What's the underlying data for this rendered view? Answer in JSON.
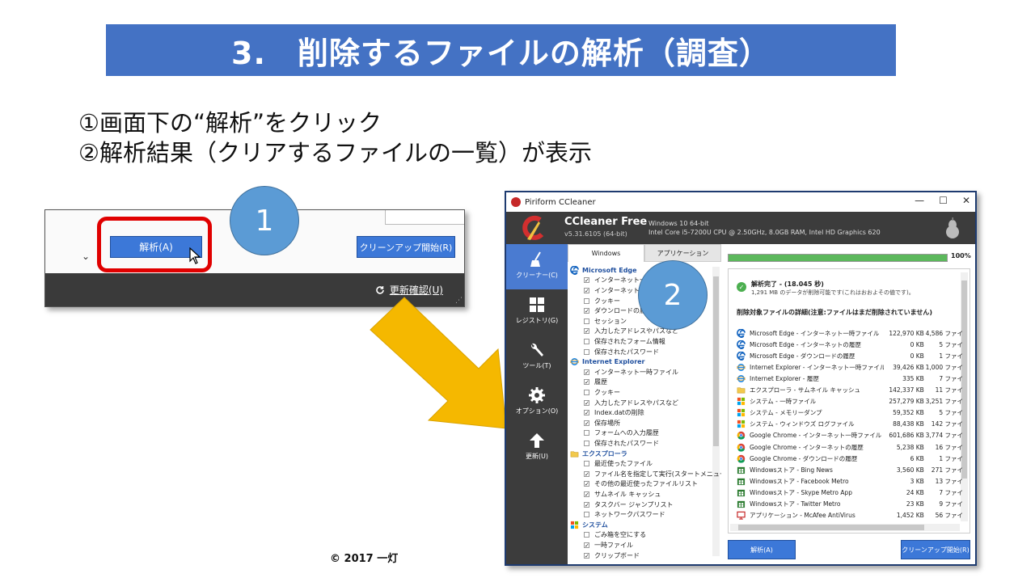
{
  "slide": {
    "title": "3.　削除するファイルの解析（調査）",
    "instruction_1": "①画面下の“解析”をクリック",
    "instruction_2": "②解析結果（クリアするファイルの一覧）が表示",
    "badge_1": "1",
    "badge_2": "2",
    "copyright": "© 2017 一灯"
  },
  "crop": {
    "analyze_button": "解析(A)",
    "cleanup_button": "クリーンアップ開始(R)",
    "update_check": "更新確認(U)",
    "chevron": "⌄"
  },
  "window": {
    "title": "Piriform CCleaner",
    "product": "CCleaner Free",
    "version": "v5.31.6105 (64-bit)",
    "system_line_1": "Windows 10 64-bit",
    "system_line_2": "Intel Core i5-7200U CPU @ 2.50GHz, 8.0GB RAM, Intel HD Graphics 620",
    "controls": {
      "minimize": "—",
      "maximize": "☐",
      "close": "✕"
    }
  },
  "sidebar": {
    "items": [
      {
        "label": "クリーナー(C)",
        "icon": "broom-icon"
      },
      {
        "label": "レジストリ(G)",
        "icon": "registry-grid-icon"
      },
      {
        "label": "ツール(T)",
        "icon": "wrench-icon"
      },
      {
        "label": "オプション(O)",
        "icon": "gear-icon"
      },
      {
        "label": "更新(U)",
        "icon": "upload-arrow-icon"
      }
    ]
  },
  "tabs": {
    "windows": "Windows",
    "applications": "アプリケーション"
  },
  "tree": [
    {
      "type": "section",
      "label": "Microsoft Edge",
      "icon": "edge-icon"
    },
    {
      "type": "item",
      "label": "インターネット一時ファイル",
      "checked": true
    },
    {
      "type": "item",
      "label": "インターネットの履歴",
      "checked": true
    },
    {
      "type": "item",
      "label": "クッキー",
      "checked": false
    },
    {
      "type": "item",
      "label": "ダウンロードの履歴",
      "checked": true
    },
    {
      "type": "item",
      "label": "セッション",
      "checked": false
    },
    {
      "type": "item",
      "label": "入力したアドレスやパスなど",
      "checked": true
    },
    {
      "type": "item",
      "label": "保存されたフォーム情報",
      "checked": false
    },
    {
      "type": "item",
      "label": "保存されたパスワード",
      "checked": false
    },
    {
      "type": "section",
      "label": "Internet Explorer",
      "icon": "ie-icon"
    },
    {
      "type": "item",
      "label": "インターネット一時ファイル",
      "checked": true
    },
    {
      "type": "item",
      "label": "履歴",
      "checked": true
    },
    {
      "type": "item",
      "label": "クッキー",
      "checked": false
    },
    {
      "type": "item",
      "label": "入力したアドレスやパスなど",
      "checked": true
    },
    {
      "type": "item",
      "label": "Index.datの削除",
      "checked": true
    },
    {
      "type": "item",
      "label": "保存場所",
      "checked": true
    },
    {
      "type": "item",
      "label": "フォームへの入力履歴",
      "checked": false
    },
    {
      "type": "item",
      "label": "保存されたパスワード",
      "checked": false
    },
    {
      "type": "section",
      "label": "エクスプローラ",
      "icon": "folder-icon"
    },
    {
      "type": "item",
      "label": "最近使ったファイル",
      "checked": false
    },
    {
      "type": "item",
      "label": "ファイル名を指定して実行(スタートメニュー)",
      "checked": true
    },
    {
      "type": "item",
      "label": "その他の最近使ったファイルリスト",
      "checked": true
    },
    {
      "type": "item",
      "label": "サムネイル キャッシュ",
      "checked": true
    },
    {
      "type": "item",
      "label": "タスクバー ジャンプリスト",
      "checked": true
    },
    {
      "type": "item",
      "label": "ネットワークパスワード",
      "checked": false
    },
    {
      "type": "section",
      "label": "システム",
      "icon": "windows-icon"
    },
    {
      "type": "item",
      "label": "ごみ箱を空にする",
      "checked": false
    },
    {
      "type": "item",
      "label": "一時ファイル",
      "checked": true
    },
    {
      "type": "item",
      "label": "クリップボード",
      "checked": true
    }
  ],
  "progress": {
    "percent_label": "100%",
    "fraction": 1.0
  },
  "result": {
    "done_title": "解析完了 - (18.045 秒)",
    "done_sub": "1,291 MB のデータが削除可能です(これはおおよその値です)。",
    "detail_title": "削除対象ファイルの詳細(注意:ファイルはまだ削除されていません)",
    "rows": [
      {
        "name": "Microsoft Edge - インターネット一時ファイル",
        "size": "122,970 KB",
        "count": "4,586 ファイ",
        "icon": "edge-icon"
      },
      {
        "name": "Microsoft Edge - インターネットの履歴",
        "size": "0 KB",
        "count": "5 ファイ",
        "icon": "edge-icon"
      },
      {
        "name": "Microsoft Edge - ダウンロードの履歴",
        "size": "0 KB",
        "count": "1 ファイ",
        "icon": "edge-icon"
      },
      {
        "name": "Internet Explorer - インターネット一時ファイル",
        "size": "39,426 KB",
        "count": "1,000 ファイ",
        "icon": "ie-icon"
      },
      {
        "name": "Internet Explorer - 履歴",
        "size": "335 KB",
        "count": "7 ファイ",
        "icon": "ie-icon"
      },
      {
        "name": "エクスプローラ - サムネイル キャッシュ",
        "size": "142,337 KB",
        "count": "11 ファイ",
        "icon": "folder-icon"
      },
      {
        "name": "システム - 一時ファイル",
        "size": "257,279 KB",
        "count": "3,251 ファイ",
        "icon": "windows-icon"
      },
      {
        "name": "システム - メモリーダンプ",
        "size": "59,352 KB",
        "count": "5 ファイ",
        "icon": "windows-icon"
      },
      {
        "name": "システム - ウィンドウズ ログファイル",
        "size": "88,438 KB",
        "count": "142 ファイ",
        "icon": "windows-icon"
      },
      {
        "name": "Google Chrome - インターネット一時ファイル",
        "size": "601,686 KB",
        "count": "3,774 ファイ",
        "icon": "chrome-icon"
      },
      {
        "name": "Google Chrome - インターネットの履歴",
        "size": "5,238 KB",
        "count": "16 ファイ",
        "icon": "chrome-icon"
      },
      {
        "name": "Google Chrome - ダウンロードの履歴",
        "size": "6 KB",
        "count": "1 ファイ",
        "icon": "chrome-icon"
      },
      {
        "name": "Windowsストア - Bing News",
        "size": "3,560 KB",
        "count": "271 ファイ",
        "icon": "store-icon"
      },
      {
        "name": "Windowsストア - Facebook Metro",
        "size": "3 KB",
        "count": "13 ファイ",
        "icon": "store-icon"
      },
      {
        "name": "Windowsストア - Skype Metro App",
        "size": "24 KB",
        "count": "7 ファイ",
        "icon": "store-icon"
      },
      {
        "name": "Windowsストア - Twitter Metro",
        "size": "23 KB",
        "count": "9 ファイ",
        "icon": "store-icon"
      },
      {
        "name": "アプリケーション - McAfee AntiVirus",
        "size": "1,452 KB",
        "count": "56 ファイ",
        "icon": "monitor-icon"
      }
    ]
  },
  "buttons": {
    "analyze": "解析(A)",
    "cleanup": "クリーンアップ開始(R)"
  },
  "colors": {
    "title_bg": "#4472c4",
    "badge": "#5b9bd5",
    "button": "#3c78d8",
    "highlight": "#e00000",
    "arrow": "#f5b800",
    "progress": "#5cb85c"
  }
}
